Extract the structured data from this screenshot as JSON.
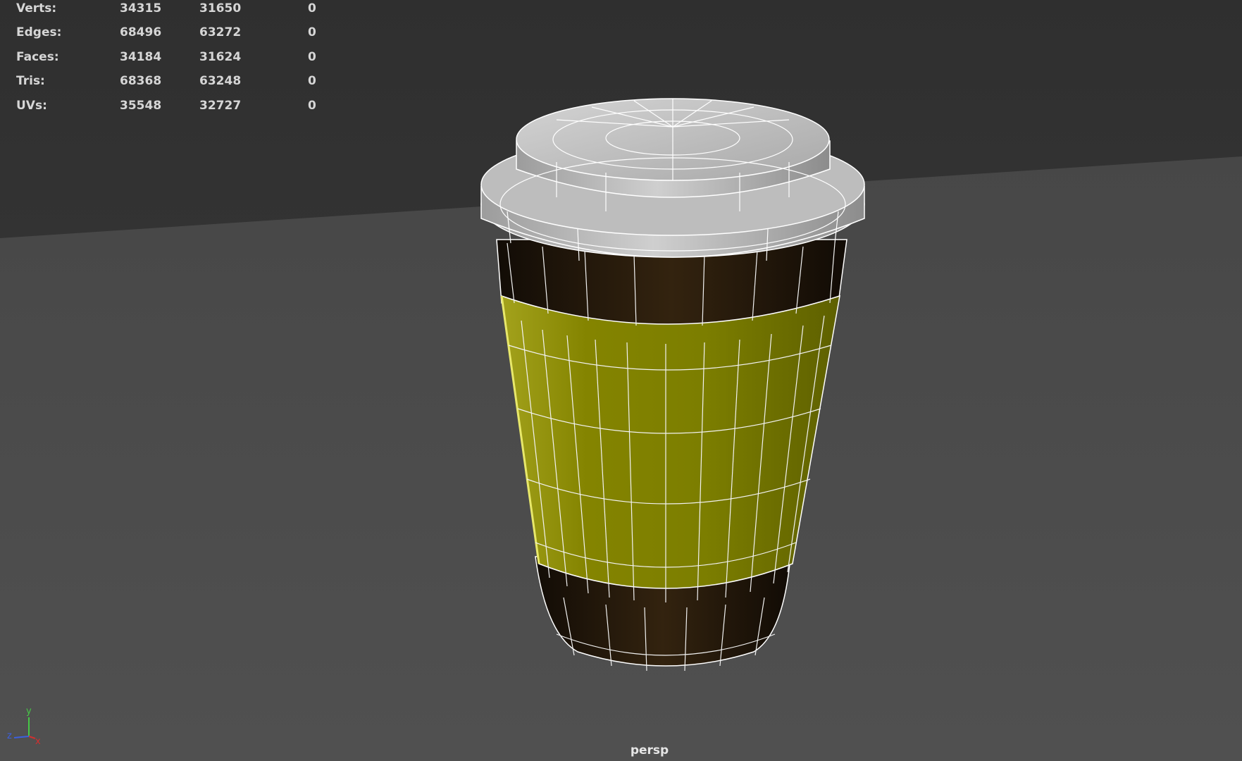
{
  "stats": {
    "rows": [
      {
        "label": "Verts:",
        "values": [
          "34315",
          "31650",
          "0"
        ]
      },
      {
        "label": "Edges:",
        "values": [
          "68496",
          "63272",
          "0"
        ]
      },
      {
        "label": "Faces:",
        "values": [
          "34184",
          "31624",
          "0"
        ]
      },
      {
        "label": "Tris:",
        "values": [
          "68368",
          "63248",
          "0"
        ]
      },
      {
        "label": "UVs:",
        "values": [
          "35548",
          "32727",
          "0"
        ]
      }
    ]
  },
  "camera": {
    "name": "persp"
  },
  "axis": {
    "x": "x",
    "y": "y",
    "z": "z"
  },
  "colors": {
    "background": "#3a3a3a",
    "ground": "#4a4a4a",
    "lid": "#b9b9b9",
    "cup_dark": "#2a1d10",
    "sleeve": "#7f8200",
    "wire": "#ffffff",
    "axis_x": "#d23030",
    "axis_y": "#46c846",
    "axis_z": "#3c60e0"
  }
}
